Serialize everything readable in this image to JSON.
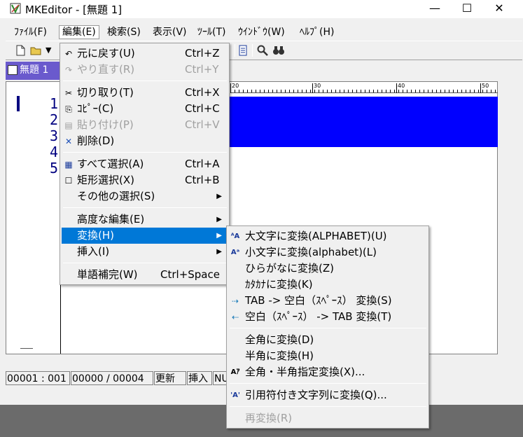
{
  "window": {
    "title": "MKEditor - [無題 1]",
    "min_glyph": "—",
    "max_glyph": "☐",
    "close_glyph": "✕"
  },
  "menubar": {
    "items": [
      "ﾌｧｲﾙ(F)",
      "編集(E)",
      "検索(S)",
      "表示(V)",
      "ﾂｰﾙ(T)",
      "ｳｲﾝﾄﾞｳ(W)",
      "ﾍﾙﾌﾟ(H)"
    ]
  },
  "tab": {
    "label": "無題 1"
  },
  "editor": {
    "line_numbers": [
      "1",
      "2",
      "3",
      "4",
      "5"
    ],
    "ruler_ticks": [
      "20",
      "30",
      "40",
      "50"
    ]
  },
  "statusbar": {
    "position": "00001 : 001",
    "count": "00000 / 00004",
    "modified": "更新",
    "mode": "挿入",
    "encoding": "NU"
  },
  "edit_menu": {
    "items": [
      {
        "label": "元に戻す(U)",
        "shortcut": "Ctrl+Z",
        "icon": "↶",
        "disabled": false
      },
      {
        "label": "やり直す(R)",
        "shortcut": "Ctrl+Y",
        "icon": "↷",
        "disabled": true
      },
      {
        "label": "切り取り(T)",
        "shortcut": "Ctrl+X",
        "icon": "✂",
        "disabled": false
      },
      {
        "label": "ｺﾋﾟｰ(C)",
        "shortcut": "Ctrl+C",
        "icon": "⎘",
        "disabled": false
      },
      {
        "label": "貼り付け(P)",
        "shortcut": "Ctrl+V",
        "icon": "▤",
        "disabled": true
      },
      {
        "label": "削除(D)",
        "shortcut": "",
        "icon": "✕",
        "disabled": false
      },
      {
        "label": "すべて選択(A)",
        "shortcut": "Ctrl+A",
        "icon": "▦",
        "disabled": false
      },
      {
        "label": "矩形選択(X)",
        "shortcut": "Ctrl+B",
        "icon": "☐",
        "disabled": false
      },
      {
        "label": "その他の選択(S)",
        "shortcut": "",
        "icon": "",
        "disabled": false
      },
      {
        "label": "高度な編集(E)",
        "shortcut": "",
        "icon": "",
        "disabled": false
      },
      {
        "label": "変換(H)",
        "shortcut": "",
        "icon": "",
        "disabled": false
      },
      {
        "label": "挿入(I)",
        "shortcut": "",
        "icon": "",
        "disabled": false
      },
      {
        "label": "単語補完(W)",
        "shortcut": "Ctrl+Space",
        "icon": "",
        "disabled": false
      }
    ],
    "submenu_arrow": "▶"
  },
  "convert_menu": {
    "items": [
      {
        "label": "大文字に変換(ALPHABET)(U)",
        "icon": "ᴬA",
        "disabled": false
      },
      {
        "label": "小文字に変換(alphabet)(L)",
        "icon": "Aᵃ",
        "disabled": false
      },
      {
        "label": "ひらがなに変換(Z)",
        "icon": "",
        "disabled": false
      },
      {
        "label": "ｶﾀｶﾅに変換(K)",
        "icon": "",
        "disabled": false
      },
      {
        "label": "TAB -> 空白（ｽﾍﾟｰｽ） 変換(S)",
        "icon": "⇢",
        "disabled": false
      },
      {
        "label": "空白（ｽﾍﾟｰｽ） -> TAB 変換(T)",
        "icon": "⇠",
        "disabled": false
      },
      {
        "label": "全角に変換(D)",
        "icon": "",
        "disabled": false
      },
      {
        "label": "半角に変換(H)",
        "icon": "",
        "disabled": false
      },
      {
        "label": "全角・半角指定変換(X)...",
        "icon": "Aｱ",
        "disabled": false
      },
      {
        "label": "引用符付き文字列に変換(Q)...",
        "icon": "'A'",
        "disabled": false
      },
      {
        "label": "再変換(R)",
        "icon": "",
        "disabled": true
      }
    ]
  }
}
